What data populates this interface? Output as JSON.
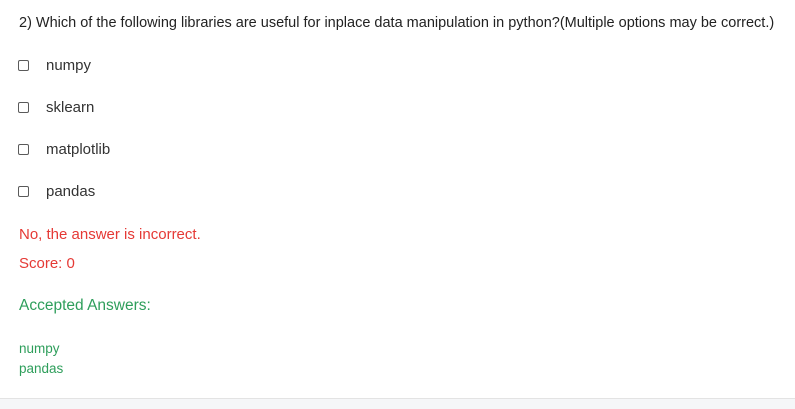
{
  "question": {
    "text": "2) Which of the following libraries are useful for inplace data manipulation in python?(Multiple options may be correct.)"
  },
  "options": [
    {
      "label": "numpy",
      "checked": false
    },
    {
      "label": "sklearn",
      "checked": false
    },
    {
      "label": "matplotlib",
      "checked": false
    },
    {
      "label": "pandas",
      "checked": false
    }
  ],
  "feedback": {
    "message": "No, the answer is incorrect.",
    "score": "Score: 0",
    "color": "#e53935"
  },
  "accepted": {
    "title": "Accepted Answers:",
    "answers": [
      "numpy",
      "pandas"
    ],
    "color": "#2e9e5b"
  }
}
